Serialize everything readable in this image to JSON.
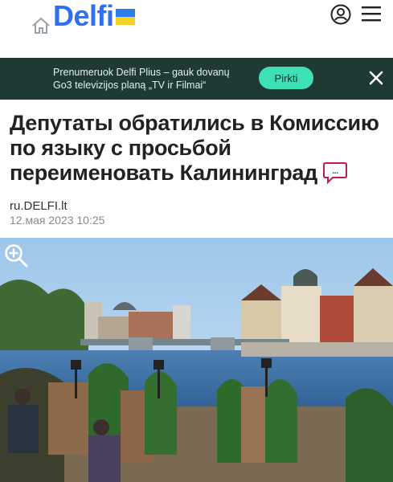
{
  "header": {
    "logo_text": "Delfi",
    "flag_colors": [
      "#2d7ee8",
      "#f6d12a"
    ],
    "icons": [
      "home-icon",
      "user-icon",
      "menu-icon"
    ]
  },
  "promo": {
    "line1": "Prenumeruok Delfi Plius – gauk dovanų",
    "line2": "Go3 televizijos planą „TV ir Filmai“",
    "button_label": "Pirkti",
    "close_icon": "close-icon",
    "background": "#1f3a35",
    "button_color": "#3ee0b5"
  },
  "article": {
    "headline": "Депутаты обратились в Комиссию по языку с просьбой переименовать Калининград",
    "comment_icon": "comment-bubble-icon",
    "comment_label": "...",
    "source": "ru.DELFI.lt",
    "datetime": "12.мая 2023 10:25",
    "zoom_icon": "zoom-in-icon"
  }
}
